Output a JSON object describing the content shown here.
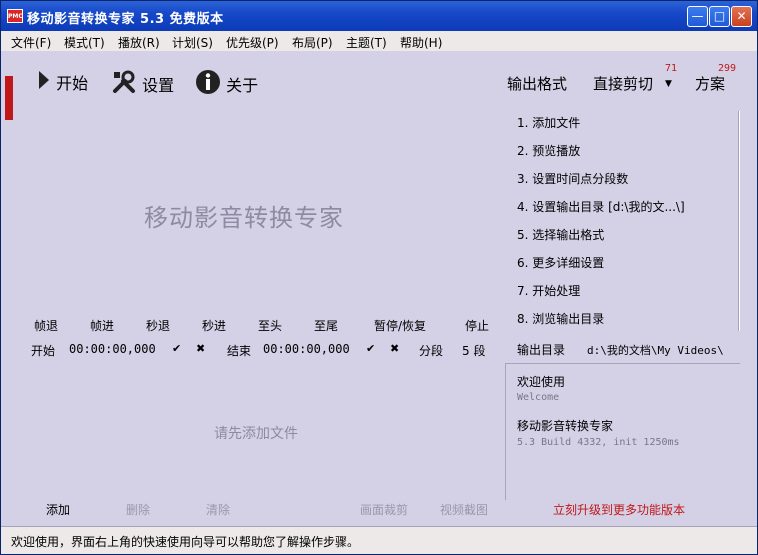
{
  "window": {
    "title": "移动影音转换专家  5.3 免费版本",
    "logo_text": "PMC",
    "minimize": "—",
    "maximize": "□",
    "close": "✕"
  },
  "menu": [
    "文件(F)",
    "模式(T)",
    "播放(R)",
    "计划(S)",
    "优先级(P)",
    "布局(P)",
    "主题(T)",
    "帮助(H)"
  ],
  "toolbar": {
    "start_label": "开始",
    "settings_label": "设置",
    "about_label": "关于",
    "output_format_label": "输出格式",
    "direct_cut_label": "直接剪切",
    "direct_cut_count": "71",
    "plan_label": "方案",
    "plan_count": "299"
  },
  "watermark": "移动影音转换专家",
  "steps": [
    "1. 添加文件",
    "2. 预览播放",
    "3. 设置时间点分段数",
    "4. 设置输出目录 [d:\\我的文...\\]",
    "5. 选择输出格式",
    "6. 更多详细设置",
    "7. 开始处理",
    "8. 浏览输出目录"
  ],
  "controls": [
    "帧退",
    "帧进",
    "秒退",
    "秒进",
    "至头",
    "至尾",
    "暂停/恢复",
    "停止"
  ],
  "timecode": {
    "start_label": "开始",
    "start_time": "00:00:00,000",
    "end_label": "结束",
    "end_time": "00:00:00,000",
    "segment_label": "分段",
    "segment_value": "5 段",
    "check": "✔",
    "cross": "✖"
  },
  "hint": "请先添加文件",
  "output_dir": {
    "label": "输出目录",
    "value": "d:\\我的文档\\My Videos\\"
  },
  "info": {
    "welcome": "欢迎使用",
    "welcome_en": "Welcome",
    "product": "移动影音转换专家",
    "build": "5.3 Build 4332, init 1250ms"
  },
  "bottom_buttons": {
    "add": "添加",
    "delete": "删除",
    "clear": "清除",
    "crop": "画面裁剪",
    "snapshot": "视频截图"
  },
  "upgrade_link": "立刻升级到更多功能版本",
  "status": "欢迎使用，界面右上角的快速使用向导可以帮助您了解操作步骤。",
  "colors": {
    "background": "#d4d0e6",
    "accent_red": "#c01818",
    "titlebar_blue": "#1648c8",
    "disabled_text": "#9a96ac"
  }
}
